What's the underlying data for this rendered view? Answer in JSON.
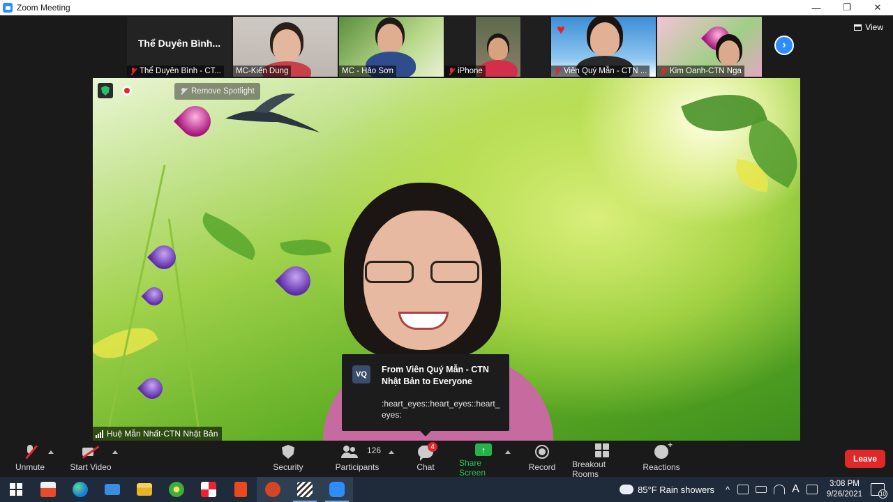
{
  "window": {
    "title": "Zoom Meeting",
    "controls": {
      "minimize": "—",
      "maximize": "❐",
      "close": "✕"
    }
  },
  "gallery_strip": {
    "tiles": [
      {
        "display_name": "Thể Duyên Bình...",
        "label": "Thể Duyên Bình - CT...",
        "muted": true
      },
      {
        "label": "MC-Kiến Dung",
        "muted": false
      },
      {
        "label": "MC - Hảo Sơn",
        "muted": false
      },
      {
        "label": "iPhone",
        "muted": true
      },
      {
        "label": "Viên Quý Mẫn - CTN ...",
        "muted": true
      },
      {
        "label": "Kim Oanh-CTN Nga",
        "muted": true
      }
    ],
    "next_icon": "chevron-right-icon",
    "next_glyph": "›"
  },
  "view_button": {
    "label": "View"
  },
  "main_video": {
    "remove_spotlight_label": "Remove Spotlight",
    "speaker_name": "Huệ Mẫn Nhất-CTN Nhật Bản"
  },
  "chat_toast": {
    "avatar_initials": "VQ",
    "from": "From Viên Quý Mẫn - CTN Nhật Bản to Everyone",
    "message": ":heart_eyes::heart_eyes::heart_eyes:"
  },
  "toolbar": {
    "unmute": "Unmute",
    "start_video": "Start Video",
    "security": "Security",
    "participants": "Participants",
    "participants_count": "126",
    "chat": "Chat",
    "chat_badge": "4",
    "share_screen": "Share Screen",
    "share_glyph": "↑",
    "record": "Record",
    "breakout_rooms": "Breakout Rooms",
    "reactions": "Reactions",
    "leave": "Leave"
  },
  "taskbar": {
    "weather": "85°F  Rain showers",
    "tray_caret": "^",
    "tray_letter": "A",
    "time": "3:08 PM",
    "date": "9/26/2021",
    "notifications": "10"
  },
  "colors": {
    "zoom_blue": "#2d8cff",
    "leave_red": "#e02828",
    "share_green": "#24b24b",
    "taskbar_bg": "#1f2b3a"
  }
}
